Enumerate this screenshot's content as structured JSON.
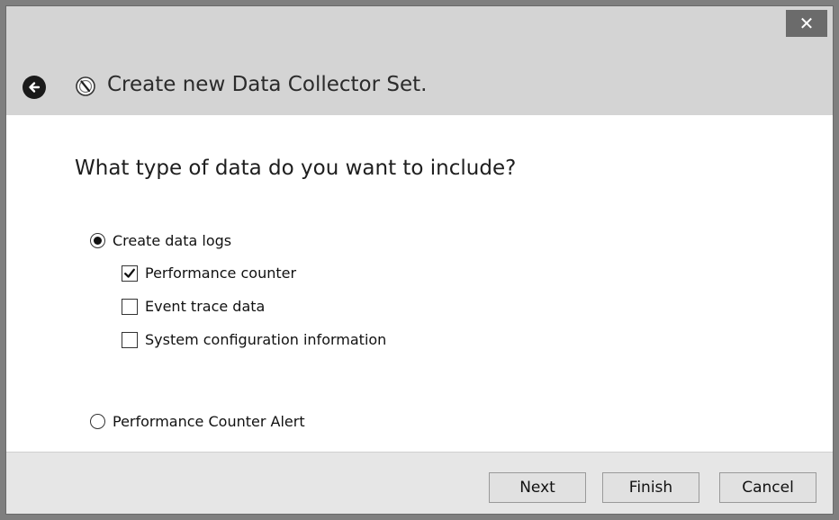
{
  "window": {
    "close_glyph": "✕",
    "title": "Create new Data Collector Set."
  },
  "icons": {
    "back": "back-arrow-icon",
    "app": "data-collector-set-icon",
    "close": "close-icon",
    "check": "checkmark-icon"
  },
  "main": {
    "question": "What type of data do you want to include?",
    "options": {
      "create_logs": {
        "label": "Create data logs",
        "selected": true
      },
      "performance_counter": {
        "label": "Performance counter",
        "checked": true
      },
      "event_trace": {
        "label": "Event trace data",
        "checked": false
      },
      "system_config": {
        "label": "System configuration information",
        "checked": false
      },
      "counter_alert": {
        "label": "Performance Counter Alert",
        "selected": false
      }
    }
  },
  "footer": {
    "next_label": "Next",
    "finish_label": "Finish",
    "cancel_label": "Cancel"
  },
  "colors": {
    "titlebar_bg": "#d4d4d4",
    "content_bg": "#ffffff",
    "footer_bg": "#e6e6e6",
    "close_button_bg": "#6b6b6b"
  }
}
